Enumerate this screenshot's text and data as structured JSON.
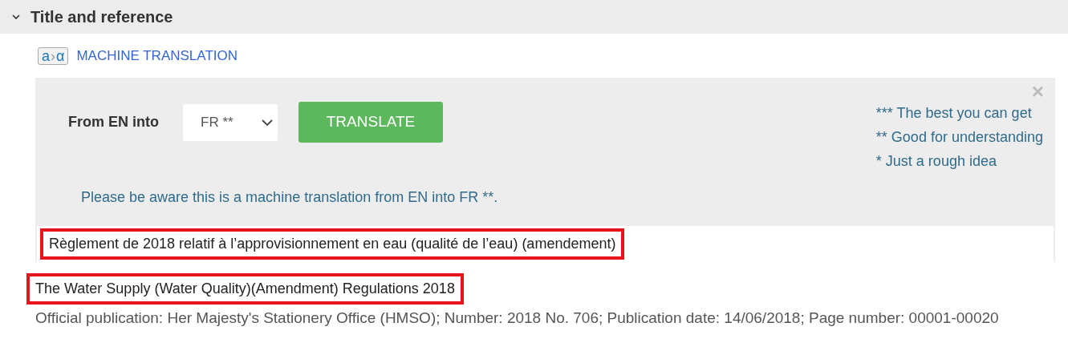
{
  "section": {
    "title": "Title and reference",
    "expanded": true
  },
  "machine_translation": {
    "icon_glyphs": [
      "a",
      "›",
      "α"
    ],
    "link": "MACHINE TRANSLATION",
    "label": "From EN into",
    "language_select": {
      "value": "FR **"
    },
    "translate_button": "TRANSLATE",
    "close": "×",
    "legend": [
      "*** The best you can get",
      "** Good for understanding",
      "* Just a rough idea"
    ],
    "notice": "Please be aware this is a machine translation from EN into FR **.",
    "translated_title": {
      "text": "Règlement de 2018 relatif à l’approvisionnement en eau (qualité de l’eau) (amendement)",
      "highlighted": true
    }
  },
  "title": {
    "text": "The Water Supply (Water Quality)(Amendment) Regulations 2018",
    "highlighted": true
  },
  "publication": "Official publication: Her Majesty's Stationery Office (HMSO); Number: 2018 No. 706; Publication date: 14/06/2018; Page number: 00001-00020"
}
